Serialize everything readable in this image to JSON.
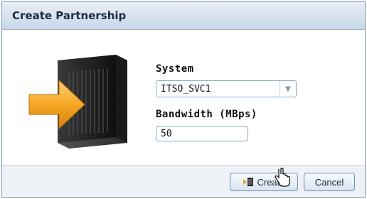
{
  "dialog": {
    "title": "Create Partnership"
  },
  "form": {
    "system_label": "System",
    "system_value": "ITSO_SVC1",
    "bandwidth_label": "Bandwidth (MBps)",
    "bandwidth_value": "50"
  },
  "buttons": {
    "create_label": "Create",
    "cancel_label": "Cancel"
  },
  "icons": {
    "illustration": "server-with-arrow-icon",
    "create": "partnership-icon",
    "dropdown": "chevron-down-icon",
    "cursor": "hand-pointer-icon"
  },
  "colors": {
    "titlebar": "#c9d7e8",
    "arrow": "#f0a020",
    "border": "#7a9ac0"
  }
}
